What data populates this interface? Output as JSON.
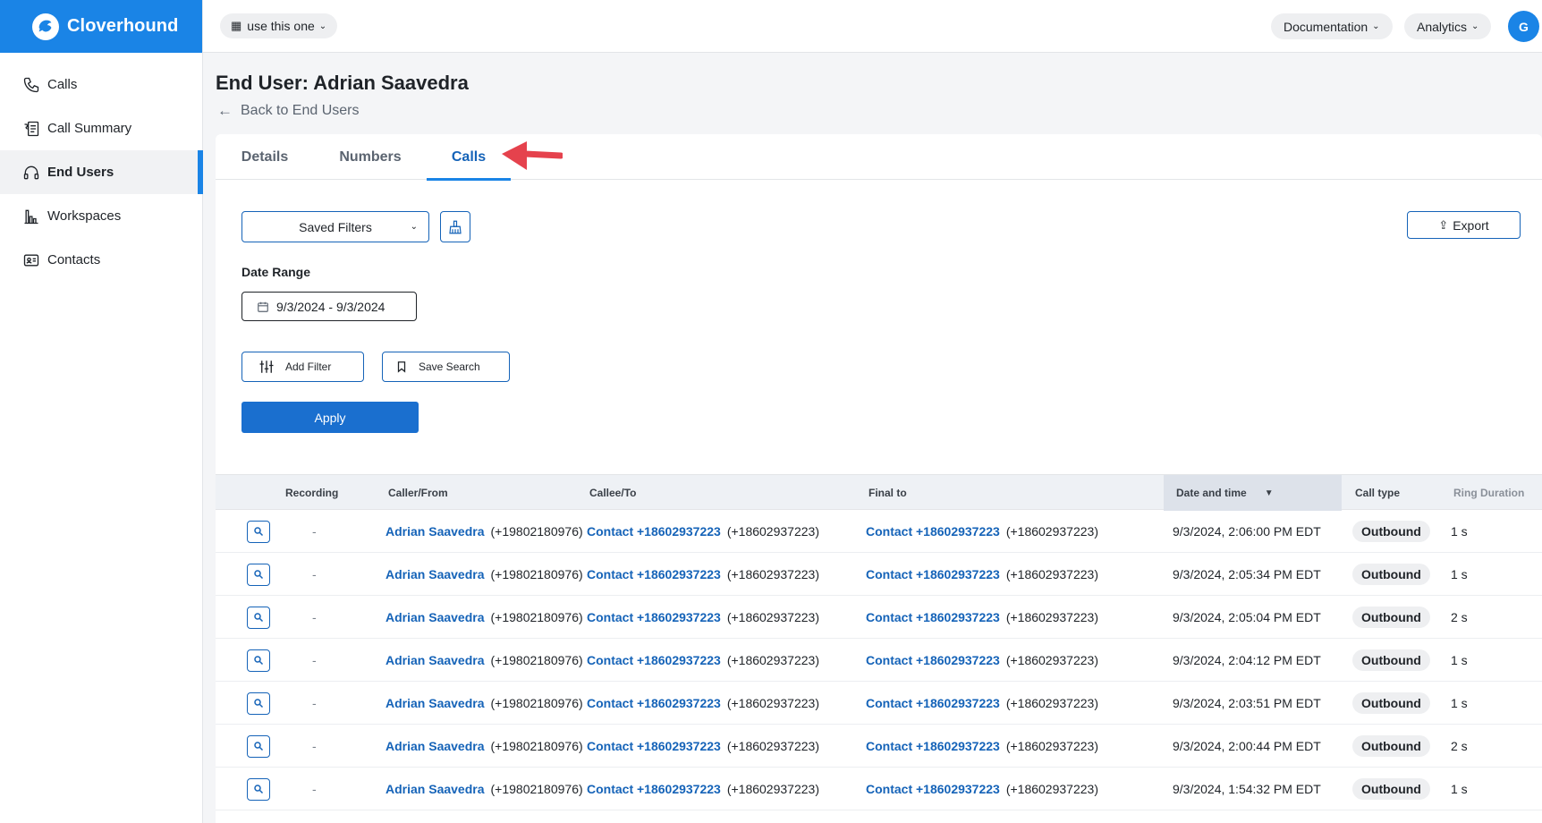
{
  "brand": {
    "name": "Cloverhound",
    "color": "#1a84e6"
  },
  "sidebar": {
    "items": [
      {
        "label": "Calls",
        "icon": "phone-icon"
      },
      {
        "label": "Call Summary",
        "icon": "call-summary-icon"
      },
      {
        "label": "End Users",
        "icon": "headset-icon",
        "active": true
      },
      {
        "label": "Workspaces",
        "icon": "building-chart-icon"
      },
      {
        "label": "Contacts",
        "icon": "contact-card-icon"
      }
    ]
  },
  "topbar": {
    "workspace": "use this one",
    "documentation": "Documentation",
    "analytics": "Analytics",
    "avatar_initial": "G"
  },
  "header": {
    "title": "End User: Adrian Saavedra",
    "back_link": "Back to End Users"
  },
  "tabs": [
    {
      "label": "Details"
    },
    {
      "label": "Numbers"
    },
    {
      "label": "Calls",
      "active": true
    }
  ],
  "filters": {
    "saved_filters": "Saved Filters",
    "export": "Export",
    "date_range_label": "Date Range",
    "date_range_value": "9/3/2024 - 9/3/2024",
    "add_filter": "Add Filter",
    "save_search": "Save Search",
    "apply": "Apply"
  },
  "table": {
    "columns": [
      "Recording",
      "Caller/From",
      "Callee/To",
      "Final to",
      "Date and time",
      "Call type",
      "Ring Duration"
    ],
    "sorted_column": "Date and time",
    "rows": [
      {
        "recording": "-",
        "caller_name": "Adrian Saavedra",
        "caller_num": "(+19802180976)",
        "callee_name": "Contact +18602937223",
        "callee_num": "(+18602937223)",
        "final_name": "Contact +18602937223",
        "final_num": "(+18602937223)",
        "date": "9/3/2024, 2:06:00 PM EDT",
        "type": "Outbound",
        "ring": "1 s"
      },
      {
        "recording": "-",
        "caller_name": "Adrian Saavedra",
        "caller_num": "(+19802180976)",
        "callee_name": "Contact +18602937223",
        "callee_num": "(+18602937223)",
        "final_name": "Contact +18602937223",
        "final_num": "(+18602937223)",
        "date": "9/3/2024, 2:05:34 PM EDT",
        "type": "Outbound",
        "ring": "1 s"
      },
      {
        "recording": "-",
        "caller_name": "Adrian Saavedra",
        "caller_num": "(+19802180976)",
        "callee_name": "Contact +18602937223",
        "callee_num": "(+18602937223)",
        "final_name": "Contact +18602937223",
        "final_num": "(+18602937223)",
        "date": "9/3/2024, 2:05:04 PM EDT",
        "type": "Outbound",
        "ring": "2 s"
      },
      {
        "recording": "-",
        "caller_name": "Adrian Saavedra",
        "caller_num": "(+19802180976)",
        "callee_name": "Contact +18602937223",
        "callee_num": "(+18602937223)",
        "final_name": "Contact +18602937223",
        "final_num": "(+18602937223)",
        "date": "9/3/2024, 2:04:12 PM EDT",
        "type": "Outbound",
        "ring": "1 s"
      },
      {
        "recording": "-",
        "caller_name": "Adrian Saavedra",
        "caller_num": "(+19802180976)",
        "callee_name": "Contact +18602937223",
        "callee_num": "(+18602937223)",
        "final_name": "Contact +18602937223",
        "final_num": "(+18602937223)",
        "date": "9/3/2024, 2:03:51 PM EDT",
        "type": "Outbound",
        "ring": "1 s"
      },
      {
        "recording": "-",
        "caller_name": "Adrian Saavedra",
        "caller_num": "(+19802180976)",
        "callee_name": "Contact +18602937223",
        "callee_num": "(+18602937223)",
        "final_name": "Contact +18602937223",
        "final_num": "(+18602937223)",
        "date": "9/3/2024, 2:00:44 PM EDT",
        "type": "Outbound",
        "ring": "2 s"
      },
      {
        "recording": "-",
        "caller_name": "Adrian Saavedra",
        "caller_num": "(+19802180976)",
        "callee_name": "Contact +18602937223",
        "callee_num": "(+18602937223)",
        "final_name": "Contact +18602937223",
        "final_num": "(+18602937223)",
        "date": "9/3/2024, 1:54:32 PM EDT",
        "type": "Outbound",
        "ring": "1 s"
      }
    ]
  },
  "colors": {
    "accent": "#1a84e6",
    "link": "#1563b8",
    "annotation": "#e5424d"
  }
}
